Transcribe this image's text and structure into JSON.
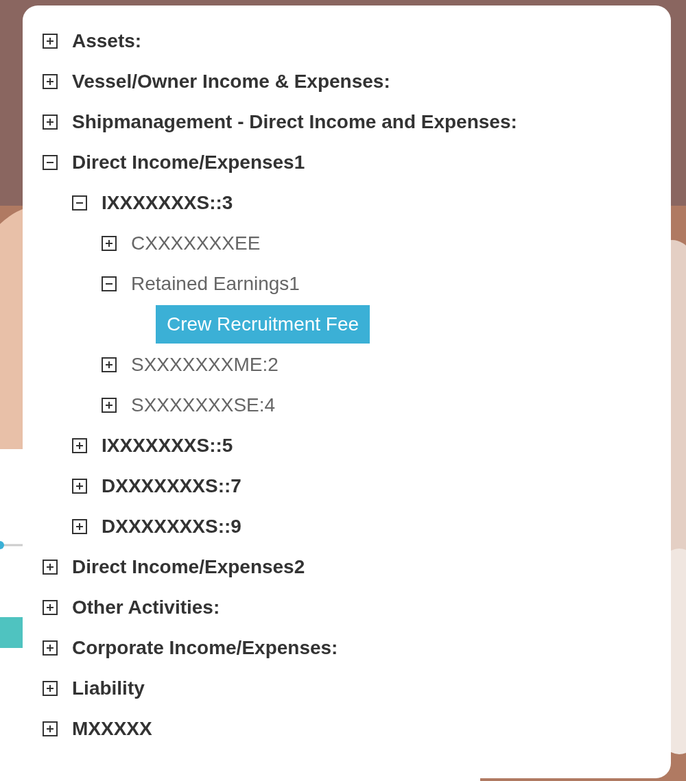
{
  "tree": [
    {
      "label": "Assets:",
      "expanded": false,
      "selected": false
    },
    {
      "label": "Vessel/Owner Income & Expenses:",
      "expanded": false,
      "selected": false
    },
    {
      "label": "Shipmanagement - Direct Income and Expenses:",
      "expanded": false,
      "selected": false
    },
    {
      "label": "Direct Income/Expenses1",
      "expanded": true,
      "selected": false,
      "children": [
        {
          "label": "IXXXXXXXS::3",
          "expanded": true,
          "selected": false,
          "children": [
            {
              "label": "CXXXXXXXEE",
              "expanded": false,
              "selected": false
            },
            {
              "label": "Retained Earnings1",
              "expanded": true,
              "selected": false,
              "children": [
                {
                  "label": "Crew Recruitment Fee",
                  "selected": true
                }
              ]
            },
            {
              "label": "SXXXXXXXME:2",
              "expanded": false,
              "selected": false
            },
            {
              "label": "SXXXXXXXSE:4",
              "expanded": false,
              "selected": false
            }
          ]
        },
        {
          "label": "IXXXXXXXS::5",
          "expanded": false,
          "selected": false
        },
        {
          "label": "DXXXXXXXS::7",
          "expanded": false,
          "selected": false
        },
        {
          "label": "DXXXXXXXS::9",
          "expanded": false,
          "selected": false
        }
      ]
    },
    {
      "label": "Direct Income/Expenses2",
      "expanded": false,
      "selected": false
    },
    {
      "label": "Other Activities:",
      "expanded": false,
      "selected": false
    },
    {
      "label": "Corporate Income/Expenses:",
      "expanded": false,
      "selected": false
    },
    {
      "label": "Liability",
      "expanded": false,
      "selected": false
    },
    {
      "label": "MXXXXX",
      "expanded": false,
      "selected": false
    }
  ]
}
